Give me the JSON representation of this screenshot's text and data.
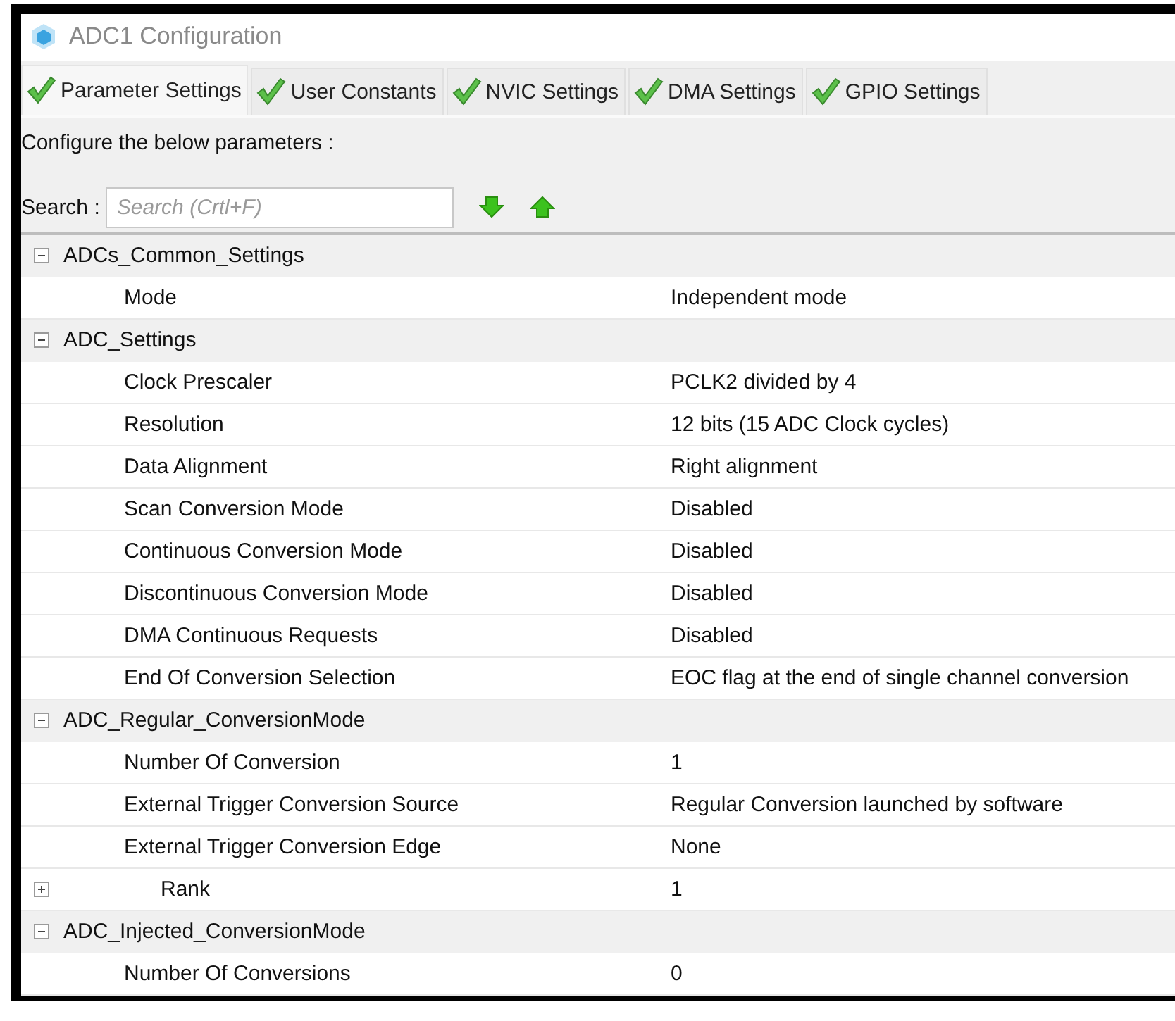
{
  "window": {
    "title": "ADC1 Configuration"
  },
  "tabs": [
    {
      "label": "Parameter Settings",
      "selected": true
    },
    {
      "label": "User Constants",
      "selected": false
    },
    {
      "label": "NVIC Settings",
      "selected": false
    },
    {
      "label": "DMA Settings",
      "selected": false
    },
    {
      "label": "GPIO Settings",
      "selected": false
    }
  ],
  "instruction": "Configure the below parameters :",
  "search": {
    "label": "Search :",
    "placeholder": "Search (Crtl+F)"
  },
  "tree": [
    {
      "name": "ADCs_Common_Settings",
      "expanded": true,
      "children": [
        {
          "name": "Mode",
          "value": "Independent mode",
          "kind": "leaf"
        }
      ]
    },
    {
      "name": "ADC_Settings",
      "expanded": true,
      "children": [
        {
          "name": "Clock Prescaler",
          "value": "PCLK2 divided by 4",
          "kind": "leaf"
        },
        {
          "name": "Resolution",
          "value": "12 bits (15 ADC Clock cycles)",
          "kind": "leaf"
        },
        {
          "name": "Data Alignment",
          "value": "Right alignment",
          "kind": "leaf"
        },
        {
          "name": "Scan Conversion Mode",
          "value": "Disabled",
          "kind": "leaf"
        },
        {
          "name": "Continuous Conversion Mode",
          "value": "Disabled",
          "kind": "leaf"
        },
        {
          "name": "Discontinuous Conversion Mode",
          "value": "Disabled",
          "kind": "leaf"
        },
        {
          "name": "DMA Continuous Requests",
          "value": "Disabled",
          "kind": "leaf"
        },
        {
          "name": "End Of Conversion Selection",
          "value": "EOC flag at the end of single channel conversion",
          "kind": "leaf"
        }
      ]
    },
    {
      "name": "ADC_Regular_ConversionMode",
      "expanded": true,
      "children": [
        {
          "name": "Number Of Conversion",
          "value": "1",
          "kind": "leaf"
        },
        {
          "name": "External Trigger Conversion Source",
          "value": "Regular Conversion launched by software",
          "kind": "leaf"
        },
        {
          "name": "External Trigger Conversion Edge",
          "value": "None",
          "kind": "leaf"
        },
        {
          "name": "Rank",
          "value": "1",
          "kind": "branch",
          "expanded": false
        }
      ]
    },
    {
      "name": "ADC_Injected_ConversionMode",
      "expanded": true,
      "children": [
        {
          "name": "Number Of Conversions",
          "value": "0",
          "kind": "leaf"
        }
      ]
    }
  ]
}
